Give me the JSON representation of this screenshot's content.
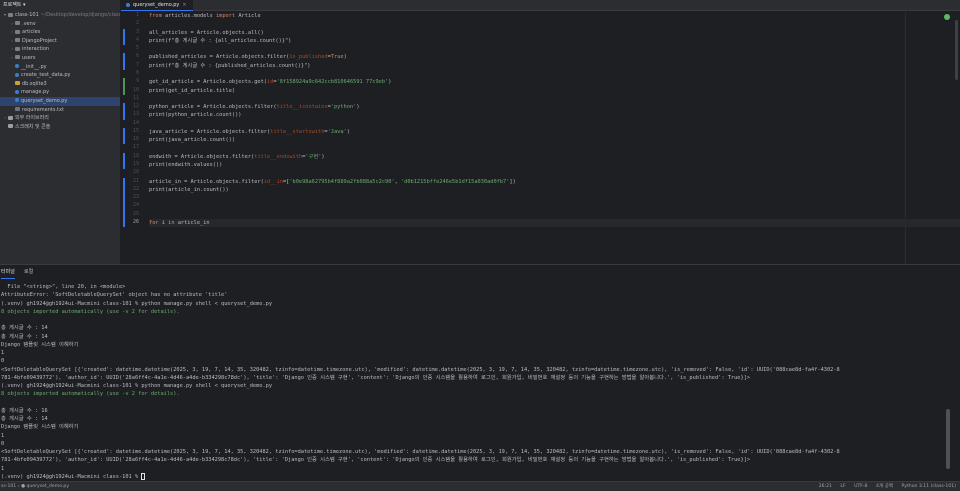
{
  "project": {
    "header": "프로젝트 ▾",
    "tree": [
      {
        "indent": 0,
        "arrow": "▾",
        "icon": "folder",
        "label": "class-101",
        "path": " ~/Desktop/develop/django/class-101",
        "selected": false
      },
      {
        "indent": 1,
        "arrow": "›",
        "icon": "folder",
        "label": ".venv",
        "path": "",
        "selected": false
      },
      {
        "indent": 1,
        "arrow": "›",
        "icon": "folder",
        "label": "articles",
        "path": "",
        "selected": false
      },
      {
        "indent": 1,
        "arrow": "›",
        "icon": "folder",
        "label": "DjangoProject",
        "path": "",
        "selected": false
      },
      {
        "indent": 1,
        "arrow": "›",
        "icon": "folder",
        "label": "interaction",
        "path": "",
        "selected": false
      },
      {
        "indent": 1,
        "arrow": "›",
        "icon": "folder",
        "label": "users",
        "path": "",
        "selected": false
      },
      {
        "indent": 1,
        "arrow": "",
        "icon": "py",
        "label": "__init__.py",
        "path": "",
        "selected": false
      },
      {
        "indent": 1,
        "arrow": "",
        "icon": "py",
        "label": "create_test_data.py",
        "path": "",
        "selected": false
      },
      {
        "indent": 1,
        "arrow": "",
        "icon": "db",
        "label": "db.sqlite3",
        "path": "",
        "selected": false
      },
      {
        "indent": 1,
        "arrow": "",
        "icon": "py",
        "label": "manage.py",
        "path": "",
        "selected": false
      },
      {
        "indent": 1,
        "arrow": "",
        "icon": "py",
        "label": "queryset_demo.py",
        "path": "",
        "selected": true
      },
      {
        "indent": 1,
        "arrow": "",
        "icon": "txt",
        "label": "requirements.txt",
        "path": "",
        "selected": false
      },
      {
        "indent": 0,
        "arrow": "›",
        "icon": "lib",
        "label": "외부 라이브러리",
        "path": "",
        "selected": false
      },
      {
        "indent": 0,
        "arrow": "",
        "icon": "lib",
        "label": "스크래치 및 콘솔",
        "path": "",
        "selected": false
      }
    ]
  },
  "editor": {
    "tab_label": "queryset_demo.py",
    "current_line": 26,
    "changes": [
      {
        "from": 3,
        "to": 4,
        "kind": "blue"
      },
      {
        "from": 6,
        "to": 7,
        "kind": "blue"
      },
      {
        "from": 9,
        "to": 10,
        "kind": "green"
      },
      {
        "from": 12,
        "to": 13,
        "kind": "blue"
      },
      {
        "from": 15,
        "to": 16,
        "kind": "blue"
      },
      {
        "from": 18,
        "to": 19,
        "kind": "blue"
      },
      {
        "from": 21,
        "to": 26,
        "kind": "blue"
      }
    ],
    "lines": [
      [
        [
          "kw",
          "from "
        ],
        [
          "t",
          "articles.models "
        ],
        [
          "kw",
          "import "
        ],
        [
          "t",
          "Article"
        ]
      ],
      [],
      [
        [
          "t",
          "all_articles = Article.objects.all()"
        ]
      ],
      [
        [
          "t",
          "print(f\"총 게시글 수 : {all_articles.count()}\")"
        ]
      ],
      [],
      [
        [
          "t",
          "published_articles = Article.objects.filter("
        ],
        [
          "kwarg",
          "is_published"
        ],
        [
          "t",
          "="
        ],
        [
          "kw",
          "True"
        ],
        [
          "t",
          ")"
        ]
      ],
      [
        [
          "t",
          "print(f\"총 게시글 수 : {published_articles.count()}\")"
        ]
      ],
      [],
      [
        [
          "t",
          "get_id_article = Article.objects.get("
        ],
        [
          "kwarg",
          "id"
        ],
        [
          "t",
          "="
        ],
        [
          "str",
          "'8f158924a9c642ccb810646591 77c9eb'"
        ],
        [
          "t",
          ")"
        ]
      ],
      [
        [
          "t",
          "print(get_id_article.title)"
        ]
      ],
      [],
      [
        [
          "t",
          "python_article = Article.objects.filter("
        ],
        [
          "kwarg",
          "title__icontains"
        ],
        [
          "t",
          "="
        ],
        [
          "str",
          "'python'"
        ],
        [
          "t",
          ")"
        ]
      ],
      [
        [
          "t",
          "print(python_article.count())"
        ]
      ],
      [],
      [
        [
          "t",
          "java_article = Article.objects.filter("
        ],
        [
          "kwarg",
          "title__startswith"
        ],
        [
          "t",
          "="
        ],
        [
          "str",
          "'Java'"
        ],
        [
          "t",
          ")"
        ]
      ],
      [
        [
          "t",
          "print(java_article.count())"
        ]
      ],
      [],
      [
        [
          "t",
          "endwith = Article.objects.filter("
        ],
        [
          "kwarg",
          "title__endswith"
        ],
        [
          "t",
          "="
        ],
        [
          "str",
          "'구현'"
        ],
        [
          "t",
          ")"
        ]
      ],
      [
        [
          "t",
          "print(endwith.values())"
        ]
      ],
      [],
      [
        [
          "t",
          "article_in = Article.objects.filter("
        ],
        [
          "kwarg",
          "id__in"
        ],
        [
          "t",
          "=["
        ],
        [
          "str",
          "'b0e98a62795b4f889a2fb088a5c2c90'"
        ],
        [
          "t",
          ", "
        ],
        [
          "str",
          "'d0b1215bffe246e5b1df15a030ad0fb7'"
        ],
        [
          "t",
          "])"
        ]
      ],
      [
        [
          "t",
          "print(article_in.count())"
        ]
      ],
      [],
      [],
      [],
      [
        [
          "kw",
          "for "
        ],
        [
          "t",
          "i "
        ],
        [
          "kw",
          "in "
        ],
        [
          "t",
          "article_in"
        ]
      ]
    ]
  },
  "terminal": {
    "tab_terminal": "터미널",
    "tab_local": "로컬",
    "lines": [
      {
        "c": "",
        "t": "  File \"<string>\", line 20, in <module>"
      },
      {
        "c": "",
        "t": "AttributeError: 'SoftDeletableQuerySet' object has no attribute 'title'"
      },
      {
        "c": "",
        "t": "(.venv) gh1924@gh1924ui-Macmini class-101 % python manage.py shell < queryset_demo.py"
      },
      {
        "c": "green",
        "t": "8 objects imported automatically (use -v 2 for details)."
      },
      {
        "c": "",
        "t": ""
      },
      {
        "c": "",
        "t": "총 게시글 수 : 14"
      },
      {
        "c": "",
        "t": "총 게시글 수 : 14"
      },
      {
        "c": "",
        "t": "Django 템플릿 시스템 이해하기"
      },
      {
        "c": "",
        "t": "1"
      },
      {
        "c": "",
        "t": "0"
      },
      {
        "c": "",
        "t": "<SoftDeletableQuerySet [{'created': datetime.datetime(2025, 3, 19, 7, 14, 35, 320482, tzinfo=datetime.timezone.utc), 'modified': datetime.datetime(2025, 3, 19, 7, 14, 35, 320482, tzinfo=datetime.timezone.utc), 'is_removed': False, 'id': UUID('088cae8d-fa4f-4302-8"
      },
      {
        "c": "",
        "t": "781-4bfe09439772'), 'author_id': UUID('28a6ff4c-4a1e-4d46-a4de-b334298c78dc'), 'title': 'Django 인증 시스템 구현', 'content': 'Django의 인증 시스템을 활용하여 로그인, 회원가입, 비밀번호 재설정 등의 기능을 구현하는 방법을 알아봅니다.', 'is_published': True}]>"
      },
      {
        "c": "",
        "t": "(.venv) gh1924@gh1924ui-Macmini class-101 % python manage.py shell < queryset_demo.py"
      },
      {
        "c": "green",
        "t": "8 objects imported automatically (use -v 2 for details)."
      },
      {
        "c": "",
        "t": ""
      },
      {
        "c": "",
        "t": "총 게시글 수 : 16"
      },
      {
        "c": "",
        "t": "총 게시글 수 : 14"
      },
      {
        "c": "",
        "t": "Django 템플릿 시스템 이해하기"
      },
      {
        "c": "",
        "t": "1"
      },
      {
        "c": "",
        "t": "0"
      },
      {
        "c": "",
        "t": "<SoftDeletableQuerySet [{'created': datetime.datetime(2025, 3, 19, 7, 14, 35, 320482, tzinfo=datetime.timezone.utc), 'modified': datetime.datetime(2025, 3, 19, 7, 14, 35, 320482, tzinfo=datetime.timezone.utc), 'is_removed': False, 'id': UUID('088cae8d-fa4f-4302-8"
      },
      {
        "c": "",
        "t": "781-4bfe09439772'), 'author_id': UUID('28a6ff4c-4a1e-4d46-a4de-b334298c78dc'), 'title': 'Django 인증 시스템 구현', 'content': 'Django의 인증 시스템을 활용하여 로그인, 회원가입, 비밀번호 재설정 등의 기능을 구현하는 방법을 알아봅니다.', 'is_published': True}]>"
      },
      {
        "c": "",
        "t": "1"
      },
      {
        "c": "prompt",
        "t": "(.venv) gh1924@gh1924ui-Macmini class-101 % "
      }
    ]
  },
  "status": {
    "breadcrumb": "ss-101 › ● queryset_demo.py",
    "position": "26:21",
    "line_sep": "LF",
    "encoding": "UTF-8",
    "indent": "4개 공백",
    "interpreter": "Python 3.11 (class-101)"
  }
}
